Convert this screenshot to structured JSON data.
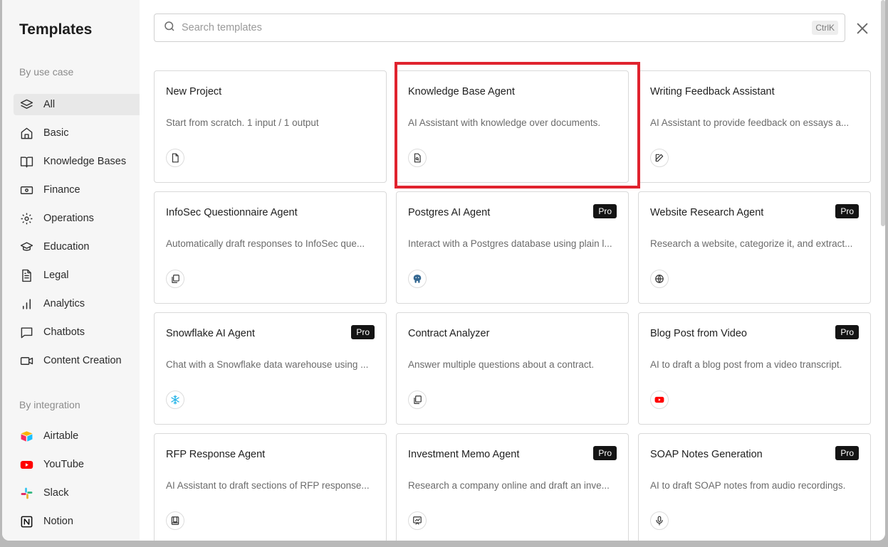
{
  "sidebar": {
    "title": "Templates",
    "use_case_label": "By use case",
    "integration_label": "By integration",
    "use_cases": [
      {
        "label": "All",
        "icon": "layers-icon"
      },
      {
        "label": "Basic",
        "icon": "home-icon"
      },
      {
        "label": "Knowledge Bases",
        "icon": "book-icon"
      },
      {
        "label": "Finance",
        "icon": "banknote-icon"
      },
      {
        "label": "Operations",
        "icon": "gear-icon"
      },
      {
        "label": "Education",
        "icon": "graduation-cap-icon"
      },
      {
        "label": "Legal",
        "icon": "document-icon"
      },
      {
        "label": "Analytics",
        "icon": "bar-chart-icon"
      },
      {
        "label": "Chatbots",
        "icon": "chat-icon"
      },
      {
        "label": "Content Creation",
        "icon": "video-camera-icon"
      }
    ],
    "integrations": [
      {
        "label": "Airtable",
        "icon": "airtable-icon"
      },
      {
        "label": "YouTube",
        "icon": "youtube-icon"
      },
      {
        "label": "Slack",
        "icon": "slack-icon"
      },
      {
        "label": "Notion",
        "icon": "notion-icon"
      }
    ]
  },
  "search": {
    "placeholder": "Search templates",
    "shortcut": "CtrlK"
  },
  "cards": [
    {
      "title": "New Project",
      "desc": "Start from scratch. 1 input / 1 output",
      "pro": "",
      "icon": "file-icon"
    },
    {
      "title": "Knowledge Base Agent",
      "desc": "AI Assistant with knowledge over documents.",
      "pro": "",
      "icon": "file-search-icon"
    },
    {
      "title": "Writing Feedback Assistant",
      "desc": "AI Assistant to provide feedback on essays a...",
      "pro": "",
      "icon": "pencil-icon"
    },
    {
      "title": "InfoSec Questionnaire Agent",
      "desc": "Automatically draft responses to InfoSec que...",
      "pro": "",
      "icon": "copy-icon"
    },
    {
      "title": "Postgres AI Agent",
      "desc": "Interact with a Postgres database using plain l...",
      "pro": "Pro",
      "icon": "postgres-icon"
    },
    {
      "title": "Website Research Agent",
      "desc": "Research a website, categorize it, and extract...",
      "pro": "Pro",
      "icon": "globe-icon"
    },
    {
      "title": "Snowflake AI Agent",
      "desc": "Chat with a Snowflake data warehouse using ...",
      "pro": "Pro",
      "icon": "snowflake-icon"
    },
    {
      "title": "Contract Analyzer",
      "desc": "Answer multiple questions about a contract.",
      "pro": "",
      "icon": "copy-icon"
    },
    {
      "title": "Blog Post from Video",
      "desc": "AI to draft a blog post from a video transcript.",
      "pro": "Pro",
      "icon": "youtube-icon"
    },
    {
      "title": "RFP Response Agent",
      "desc": "AI Assistant to draft sections of RFP response...",
      "pro": "",
      "icon": "book-square-icon"
    },
    {
      "title": "Investment Memo Agent",
      "desc": "Research a company online and draft an inve...",
      "pro": "Pro",
      "icon": "chart-presentation-icon"
    },
    {
      "title": "SOAP Notes Generation",
      "desc": "AI to draft SOAP notes from audio recordings.",
      "pro": "Pro",
      "icon": "microphone-icon"
    }
  ],
  "colors": {
    "highlight": "#e0232e",
    "pro_badge": "#141414",
    "active_nav": "#e8e8e8"
  }
}
